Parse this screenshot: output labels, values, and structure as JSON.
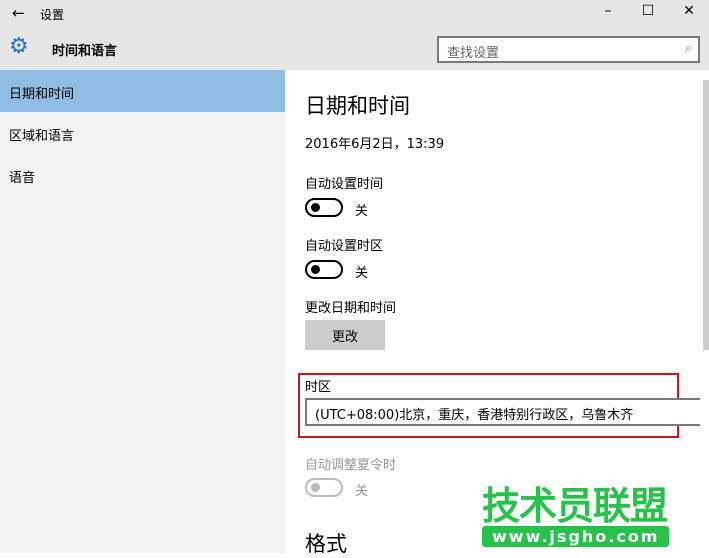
{
  "window": {
    "title": "设置",
    "back": "←",
    "minimize": "–",
    "maximize": "☐",
    "close": "✕"
  },
  "header": {
    "title": "时间和语言",
    "icon": "gear-icon",
    "search_placeholder": "查找设置",
    "search_icon": "⌕"
  },
  "sidebar": {
    "items": [
      {
        "label": "日期和时间",
        "active": true
      },
      {
        "label": "区域和语言"
      },
      {
        "label": "语音"
      }
    ]
  },
  "main": {
    "title": "日期和时间",
    "current": "2016年6月2日，13:39",
    "auto_time": {
      "label": "自动设置时间",
      "state": "关"
    },
    "auto_zone": {
      "label": "自动设置时区",
      "state": "关"
    },
    "change": {
      "label": "更改日期和时间",
      "button": "更改"
    },
    "timezone": {
      "label": "时区",
      "value": "(UTC+08:00)北京，重庆，香港特别行政区，乌鲁木齐"
    },
    "dst": {
      "label": "自动调整夏令时",
      "state": "关"
    },
    "format_title": "格式"
  },
  "watermark": {
    "name": "技术员联盟",
    "url": "www.jsgho.com"
  },
  "colors": {
    "accent": "#8fbde4",
    "highlight": "#c8171e"
  }
}
